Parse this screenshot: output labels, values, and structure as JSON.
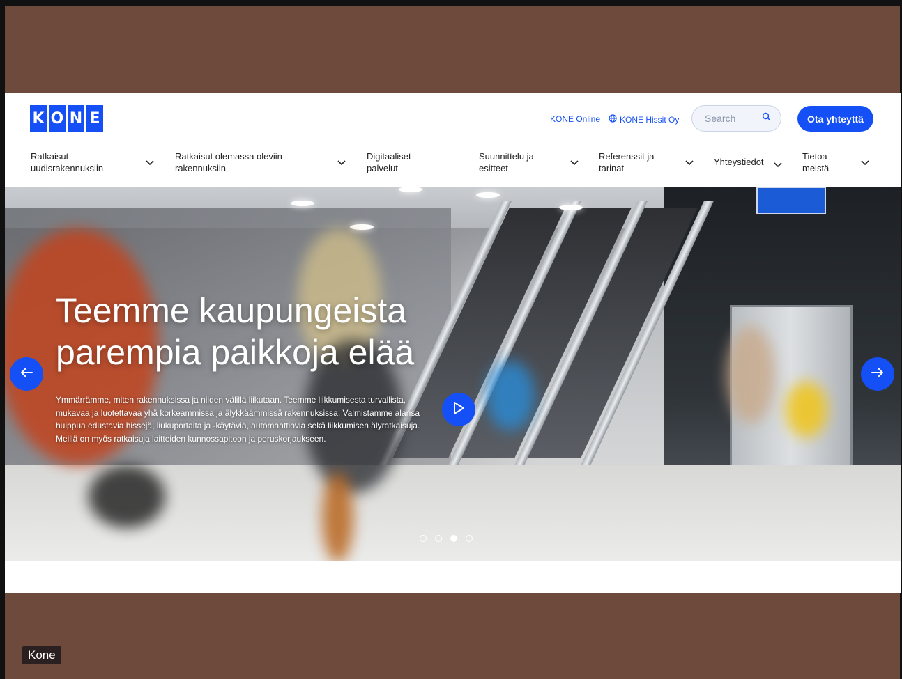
{
  "brand": {
    "logo_letters": [
      "K",
      "O",
      "N",
      "E"
    ],
    "color": "#1450f5"
  },
  "header": {
    "links": {
      "kone_online": "KONE Online",
      "kone_hissit": "KONE Hissit Oy"
    },
    "search": {
      "placeholder": "Search"
    },
    "cta_label": "Ota yhteyttä"
  },
  "nav": {
    "items": [
      {
        "line1": "Ratkaisut",
        "line2": "uudisrakennuksiin"
      },
      {
        "line1": "Ratkaisut olemassa oleviin",
        "line2": "rakennuksiin"
      },
      {
        "line1": "Digitaaliset",
        "line2": "palvelut"
      },
      {
        "line1": "Suunnittelu ja",
        "line2": "esitteet"
      },
      {
        "line1": "Referenssit ja",
        "line2": "tarinat"
      },
      {
        "line1": "Yhteystiedot",
        "line2": ""
      },
      {
        "line1": "Tietoa",
        "line2": "meistä"
      }
    ]
  },
  "hero": {
    "title_line1": "Teemme kaupungeista",
    "title_line2": "parempia paikkoja elää",
    "body": "Ymmärrämme, miten rakennuksissa ja niiden välillä liikutaan. Teemme liikkumisesta turvallista, mukavaa ja luotettavaa yhä korkeammissa ja älykkäämmissä rakennuksissa. Valmistamme alansa huippua edustavia hissejä, liukuportaita ja -käytäviä, automaattiovia sekä liikkumisen älyratkaisuja. Meillä on myös ratkaisuja laitteiden kunnossapitoon ja peruskorjaukseen.",
    "slides_total": 4,
    "active_slide": 3
  },
  "caption": "Kone"
}
